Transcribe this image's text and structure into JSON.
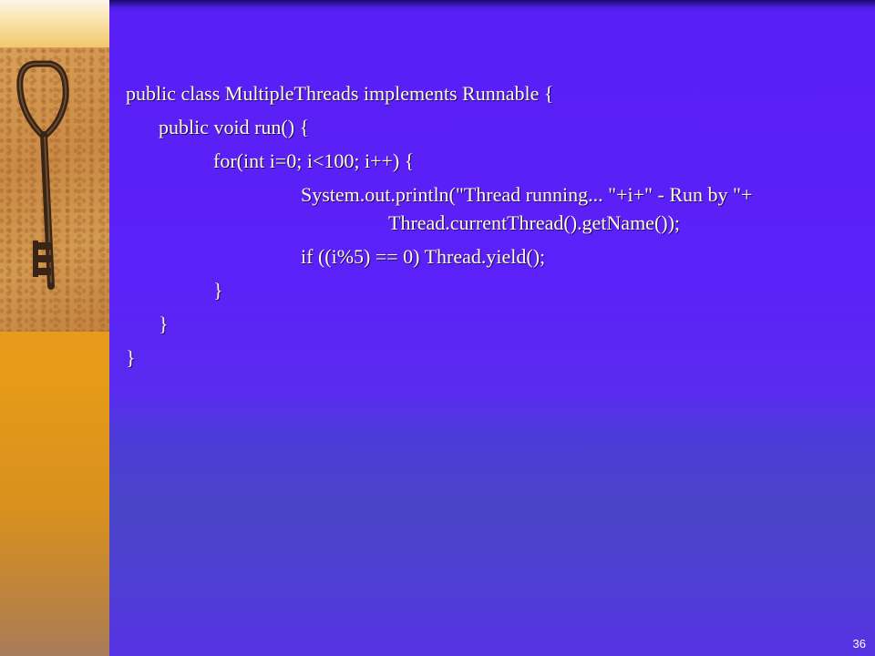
{
  "slide": {
    "code_lines": [
      "public class MultipleThreads implements Runnable {",
      "public void run() {",
      "for(int i=0; i<100; i++) {",
      "System.out.println(\"Thread running... \"+i+\" - Run by \"+",
      "Thread.currentThread().getName());",
      "if ((i%5) == 0) Thread.yield();",
      "}",
      "}",
      "}"
    ],
    "page_number": "36"
  },
  "colors": {
    "background": "#5a1ff0",
    "text": "#fffbe0",
    "left_strip": "#e8a020"
  },
  "icons": {
    "decoration": "old-key-icon"
  }
}
